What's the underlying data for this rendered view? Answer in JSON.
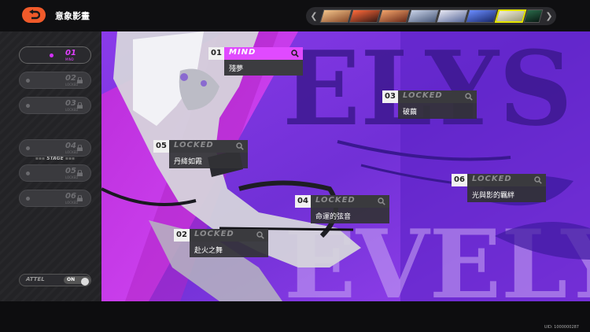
{
  "header": {
    "title": "意象影畫",
    "back_icon": "back-arrow-icon"
  },
  "characters": {
    "count_visible": 8,
    "active_index": 6
  },
  "sidebar": {
    "items": [
      {
        "num": "01",
        "sub": "MIND",
        "state": "active"
      },
      {
        "num": "02",
        "sub": "LOCKED",
        "state": "locked"
      },
      {
        "num": "03",
        "sub": "LOCKED",
        "state": "locked"
      },
      {
        "num": "04",
        "sub": "LOCKED",
        "state": "locked"
      },
      {
        "num": "05",
        "sub": "LOCKED",
        "state": "locked"
      },
      {
        "num": "06",
        "sub": "LOCKED",
        "state": "locked"
      }
    ],
    "stage_label": "STAGE",
    "toggle_label": "ATTEL",
    "toggle_value": "ON"
  },
  "scene": {
    "bg_text_top": "ELYS",
    "bg_text_bottom": "EVELY",
    "nodes": [
      {
        "num": "01",
        "label": "MIND",
        "name": "殘夢",
        "active": true
      },
      {
        "num": "03",
        "label": "LOCKED",
        "name": "破繭",
        "active": false
      },
      {
        "num": "05",
        "label": "LOCKED",
        "name": "丹絳如霞",
        "active": false
      },
      {
        "num": "06",
        "label": "LOCKED",
        "name": "光與影的羈絆",
        "active": false
      },
      {
        "num": "04",
        "label": "LOCKED",
        "name": "命運的弦音",
        "active": false
      },
      {
        "num": "02",
        "label": "LOCKED",
        "name": "赴火之舞",
        "active": false
      }
    ]
  },
  "footer": {
    "uid": "UID: 1000000287"
  },
  "colors": {
    "accent": "#e04aff",
    "back_button": "#f05a2a",
    "scene_bg": "#6a2fd0",
    "active_char": "#e4e400"
  }
}
